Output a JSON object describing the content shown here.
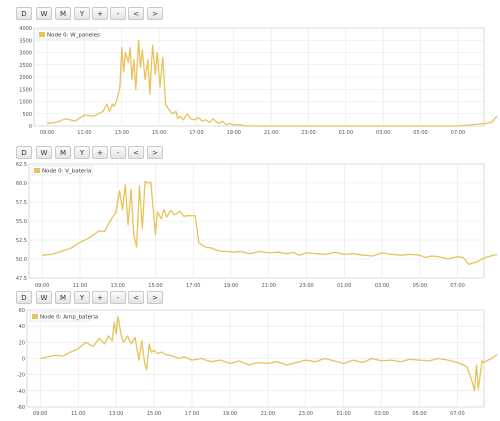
{
  "toolbar": {
    "buttons": [
      "D",
      "W",
      "M",
      "Y",
      "+",
      "-",
      "<",
      ">"
    ]
  },
  "colors": {
    "series": "#e8c25a",
    "grid": "#e6e6e6",
    "axis": "#bdbdbd",
    "plot_bg": "#ffffff"
  },
  "chart_data": [
    {
      "type": "line",
      "series": [
        {
          "name": "Node 0: W_paneles"
        }
      ],
      "x_tick_labels": [
        "09:00",
        "11:00",
        "13:00",
        "15:00",
        "17:00",
        "19:00",
        "21:00",
        "23:00",
        "01:00",
        "03:00",
        "05:00",
        "07:00"
      ],
      "yticks": [
        "0",
        "500",
        "1000",
        "1500",
        "2000",
        "2500",
        "3000",
        "3500",
        "4000"
      ],
      "ylim": [
        0,
        4000
      ],
      "x_hours": [
        0,
        0.5,
        1,
        1.5,
        2,
        2.5,
        3,
        3.2,
        3.35,
        3.5,
        3.6,
        3.75,
        3.9,
        4,
        4.1,
        4.2,
        4.35,
        4.45,
        4.55,
        4.65,
        4.75,
        4.9,
        5,
        5.1,
        5.25,
        5.4,
        5.5,
        5.65,
        5.8,
        5.9,
        6.05,
        6.2,
        6.35,
        6.5,
        6.7,
        6.9,
        7,
        7.1,
        7.3,
        7.5,
        7.7,
        7.9,
        8.1,
        8.3,
        8.5,
        8.7,
        8.9,
        9,
        9.2,
        9.4,
        9.6,
        9.8,
        10,
        10.3,
        10.5,
        10.7,
        11,
        11.3,
        12,
        14,
        16,
        18,
        20,
        22,
        23.5,
        23.8,
        24.1
      ],
      "values": [
        100,
        150,
        300,
        200,
        450,
        400,
        600,
        900,
        600,
        900,
        800,
        1100,
        1600,
        3200,
        2200,
        3000,
        2600,
        3200,
        1900,
        2700,
        1500,
        3500,
        2400,
        3100,
        1900,
        2700,
        1300,
        3300,
        2100,
        3000,
        1600,
        2800,
        900,
        700,
        500,
        600,
        300,
        400,
        250,
        500,
        300,
        250,
        350,
        200,
        250,
        150,
        300,
        200,
        100,
        200,
        50,
        100,
        40,
        60,
        20,
        10,
        5,
        0,
        0,
        0,
        0,
        0,
        0,
        0,
        100,
        150,
        400
      ]
    },
    {
      "type": "line",
      "series": [
        {
          "name": "Node 0: V_bateria"
        }
      ],
      "x_tick_labels": [
        "09:00",
        "11:00",
        "13:00",
        "15:00",
        "17:00",
        "19:00",
        "21:00",
        "23:00",
        "01:00",
        "03:00",
        "05:00",
        "07:00"
      ],
      "yticks": [
        "47.5",
        "50.0",
        "52.5",
        "55.0",
        "57.5",
        "60.0",
        "62.5"
      ],
      "ylim": [
        47.5,
        62.5
      ],
      "x_hours": [
        0,
        0.5,
        1,
        1.5,
        2,
        2.5,
        3,
        3.3,
        3.6,
        3.9,
        4.1,
        4.25,
        4.4,
        4.55,
        4.7,
        4.85,
        5,
        5.15,
        5.3,
        5.45,
        5.6,
        5.75,
        5.9,
        6,
        6.1,
        6.3,
        6.45,
        6.6,
        6.8,
        7,
        7.3,
        7.5,
        7.7,
        7.9,
        8.1,
        8.3,
        8.5,
        8.7,
        8.9,
        9.2,
        9.5,
        9.8,
        10.1,
        10.5,
        11,
        11.5,
        12,
        12.5,
        13,
        13.3,
        13.6,
        14,
        14.5,
        15,
        15.5,
        16,
        16.5,
        17,
        17.5,
        18,
        18.5,
        19,
        19.5,
        20,
        20.3,
        20.6,
        21,
        21.5,
        22,
        22.3,
        22.6,
        23,
        23.3,
        23.6,
        24.1
      ],
      "values": [
        50.5,
        50.6,
        51.0,
        51.4,
        52.2,
        52.8,
        53.7,
        53.6,
        55.0,
        56.1,
        59.0,
        56.5,
        59.8,
        54.5,
        59.2,
        53.2,
        51.6,
        59.6,
        54.0,
        60.2,
        60.0,
        60.1,
        56.0,
        53.2,
        56.2,
        55.3,
        56.5,
        55.5,
        56.4,
        55.8,
        56.3,
        55.6,
        55.7,
        55.7,
        55.7,
        52.1,
        51.8,
        51.5,
        51.5,
        51.2,
        51.0,
        51.0,
        50.9,
        51.0,
        50.7,
        51.0,
        50.8,
        50.9,
        50.7,
        50.9,
        50.5,
        50.8,
        50.7,
        50.6,
        50.9,
        50.6,
        50.7,
        50.5,
        50.4,
        50.8,
        50.6,
        50.5,
        50.6,
        50.5,
        50.2,
        50.4,
        50.3,
        50.0,
        50.3,
        50.2,
        49.3,
        49.6,
        50.0,
        50.3,
        50.6
      ]
    },
    {
      "type": "line",
      "series": [
        {
          "name": "Node 0: Amp_bateria"
        }
      ],
      "x_tick_labels": [
        "09:00",
        "11:00",
        "13:00",
        "15:00",
        "17:00",
        "19:00",
        "21:00",
        "23:00",
        "01:00",
        "03:00",
        "05:00",
        "07:00"
      ],
      "yticks": [
        "-60",
        "-40",
        "-20",
        "0",
        "20",
        "40",
        "60"
      ],
      "ylim": [
        -60,
        60
      ],
      "x_hours": [
        0,
        0.4,
        0.8,
        1.2,
        1.6,
        2,
        2.4,
        2.8,
        3.1,
        3.4,
        3.6,
        3.8,
        3.9,
        4,
        4.1,
        4.2,
        4.3,
        4.4,
        4.6,
        4.8,
        5,
        5.1,
        5.2,
        5.35,
        5.5,
        5.6,
        5.75,
        5.85,
        6,
        6.2,
        6.4,
        6.6,
        6.8,
        7,
        7.3,
        7.6,
        8,
        8.5,
        9,
        9.5,
        10,
        10.5,
        11,
        11.5,
        12,
        12.5,
        13,
        13.5,
        14,
        14.5,
        15,
        15.5,
        16,
        16.5,
        17,
        17.5,
        18,
        18.5,
        19,
        19.5,
        20,
        20.5,
        21,
        21.5,
        22,
        22.5,
        22.8,
        22.9,
        23,
        23.1,
        23.2,
        23.3,
        23.4,
        23.6,
        23.8,
        24.1
      ],
      "values": [
        0,
        2,
        4,
        3,
        8,
        12,
        20,
        15,
        25,
        18,
        28,
        22,
        45,
        30,
        52,
        38,
        25,
        20,
        28,
        18,
        26,
        12,
        -2,
        22,
        -5,
        -14,
        18,
        8,
        10,
        6,
        8,
        5,
        4,
        3,
        0,
        2,
        -2,
        0,
        -4,
        -2,
        -6,
        -3,
        -8,
        -5,
        -6,
        -4,
        -8,
        -5,
        -2,
        -4,
        0,
        -3,
        -6,
        -2,
        -5,
        0,
        -3,
        -2,
        -4,
        -1,
        -2,
        -3,
        0,
        -2,
        -5,
        -10,
        -30,
        -40,
        -8,
        -38,
        -20,
        -3,
        -5,
        -2,
        0,
        5
      ]
    }
  ]
}
